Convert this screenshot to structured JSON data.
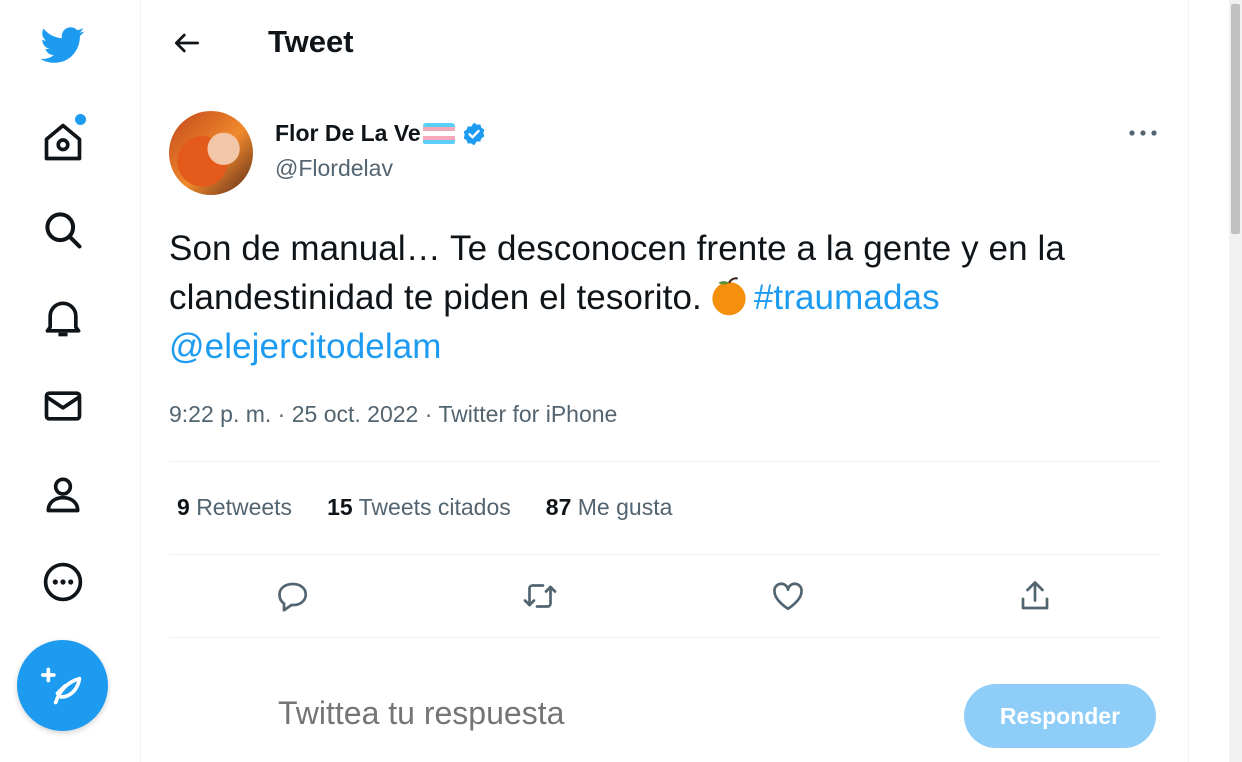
{
  "nav": {
    "items": [
      {
        "icon": "twitter-logo-icon"
      },
      {
        "icon": "home-icon",
        "has_notification": true
      },
      {
        "icon": "explore-search-icon"
      },
      {
        "icon": "notifications-bell-icon"
      },
      {
        "icon": "messages-envelope-icon"
      },
      {
        "icon": "profile-icon"
      },
      {
        "icon": "more-options-icon"
      }
    ],
    "compose_icon": "compose-tweet-icon"
  },
  "header": {
    "title": "Tweet",
    "back_icon": "back-arrow-icon"
  },
  "tweet": {
    "author_name": "Flor De La Ve",
    "author_handle": "@Flordelav",
    "verified": true,
    "text_part1": "Son de manual… Te desconocen frente a la gente y en la clandestinidad te piden el tesorito.",
    "emoji": "tangerine-emoji",
    "hashtag": "#traumadas",
    "mention": "@elejercitodelam",
    "time": "9:22 p. m.",
    "date": "25 oct. 2022",
    "source": "Twitter for iPhone",
    "meta_separator": " · "
  },
  "stats": {
    "retweets_count": "9",
    "retweets_label": "Retweets",
    "quotes_count": "15",
    "quotes_label": "Tweets citados",
    "likes_count": "87",
    "likes_label": "Me gusta"
  },
  "actions": [
    {
      "icon": "reply-icon"
    },
    {
      "icon": "retweet-icon"
    },
    {
      "icon": "like-heart-icon"
    },
    {
      "icon": "share-icon"
    }
  ],
  "reply": {
    "placeholder": "Twittea tu respuesta",
    "button_label": "Responder"
  },
  "colors": {
    "accent": "#1d9bf0",
    "text_primary": "#0f1419",
    "text_secondary": "#536471",
    "button_disabled": "#8ecdf8",
    "trans_blue": "#5bcefa",
    "trans_pink": "#f5a9b8"
  }
}
